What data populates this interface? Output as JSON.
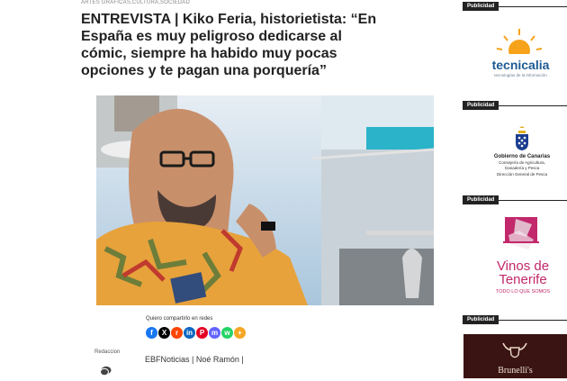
{
  "breadcrumb": {
    "categories": "ARTES GRÁFICAS,CULTURA,SOCIEDAD"
  },
  "article": {
    "title": "ENTREVISTA | Kiko Feria, historietista: “En España es muy peligroso dedicarse al cómic, siempre ha habido muy pocas opciones y te pagan una porquería”"
  },
  "share": {
    "label": "Quiero compartirlo en redes",
    "networks": [
      {
        "name": "facebook-icon",
        "glyph": "f",
        "color": "#1877f2"
      },
      {
        "name": "x-icon",
        "glyph": "X",
        "color": "#000000"
      },
      {
        "name": "reddit-icon",
        "glyph": "r",
        "color": "#ff4500"
      },
      {
        "name": "linkedin-icon",
        "glyph": "in",
        "color": "#0a66c2"
      },
      {
        "name": "pinterest-icon",
        "glyph": "P",
        "color": "#e60023"
      },
      {
        "name": "mastodon-icon",
        "glyph": "m",
        "color": "#6364ff"
      },
      {
        "name": "whatsapp-icon",
        "glyph": "w",
        "color": "#25d366"
      },
      {
        "name": "more-icon",
        "glyph": "+",
        "color": "#f5a623"
      }
    ]
  },
  "meta": {
    "author_label": "Redaccion",
    "tags": "EBFNoticias | Noé Ramón |"
  },
  "sidebar": {
    "ad_label": "Publicidad",
    "ads": [
      {
        "brand": "tecnicalia",
        "tagline": "tecnologías de la información"
      },
      {
        "line1": "Gobierno de Canarias",
        "line2": "Consejería de Agricultura,",
        "line3": "Ganadería y Pesca",
        "line4": "Dirección General de Pesca"
      },
      {
        "line1": "Vinos de",
        "line2": "Tenerife",
        "line3": "TODO LO QUE SOMOS"
      },
      {
        "brand": "Brunelli's"
      }
    ]
  },
  "colors": {
    "tecnicalia_blue": "#1e5a92",
    "tecnicalia_sun": "#f6a31b",
    "vinos_pink": "#c2286b",
    "steak_bg": "#3a1412"
  }
}
